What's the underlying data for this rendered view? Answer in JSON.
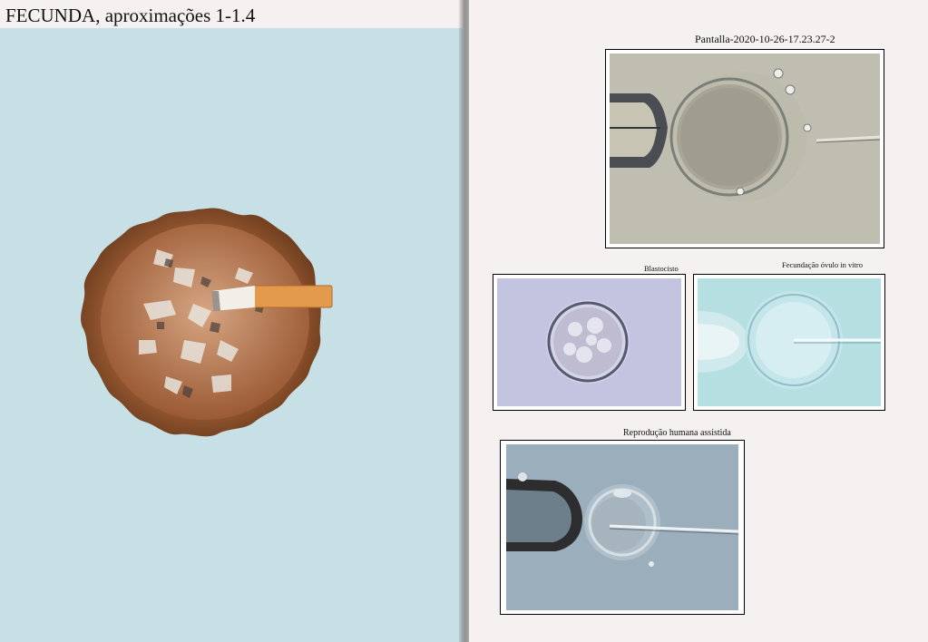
{
  "title_main": "FECUNDA",
  "title_rest": ", aproximações 1-1.4",
  "captions": {
    "top_image": "Pantalla-2020-10-26-17.23.27-2",
    "blastocyst": "Blastocisto",
    "ivf": "Fecundação óvulo in vitro",
    "assisted": "Reprodução humana assistida"
  },
  "colors": {
    "left_background": "#c6e0e5",
    "right_background": "#f6f1f1"
  }
}
